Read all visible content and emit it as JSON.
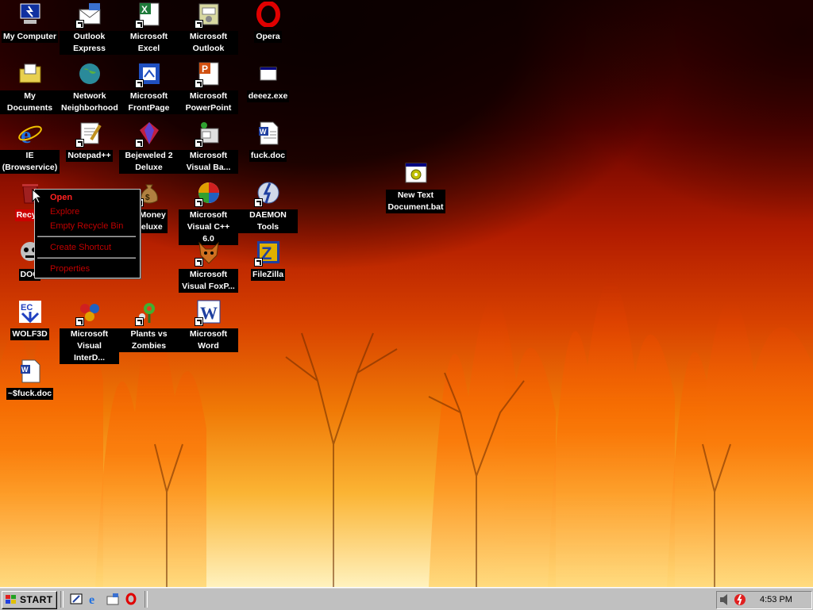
{
  "desktop": {
    "icons": [
      {
        "label": "My Computer",
        "icon": "my-computer-icon",
        "shortcut": false
      },
      {
        "label": "Outlook Express",
        "icon": "outlook-express-icon",
        "shortcut": true
      },
      {
        "label": "Microsoft Excel",
        "icon": "excel-icon",
        "shortcut": true
      },
      {
        "label": "Microsoft Outlook",
        "icon": "outlook-icon",
        "shortcut": true
      },
      {
        "label": "Opera",
        "icon": "opera-icon",
        "shortcut": false
      },
      {
        "label": "My Documents",
        "icon": "my-documents-icon",
        "shortcut": false
      },
      {
        "label": "Network Neighborhood",
        "icon": "network-neighborhood-icon",
        "shortcut": false
      },
      {
        "label": "Microsoft FrontPage",
        "icon": "frontpage-icon",
        "shortcut": true
      },
      {
        "label": "Microsoft PowerPoint",
        "icon": "powerpoint-icon",
        "shortcut": true
      },
      {
        "label": "deeez.exe",
        "icon": "exe-file-icon",
        "shortcut": false
      },
      {
        "label": "IE (Browservice)",
        "icon": "internet-explorer-icon",
        "shortcut": false
      },
      {
        "label": "Notepad++",
        "icon": "notepad-plus-plus-icon",
        "shortcut": true
      },
      {
        "label": "Bejeweled 2 Deluxe",
        "icon": "bejeweled-icon",
        "shortcut": true
      },
      {
        "label": "Microsoft Visual Ba...",
        "icon": "visual-basic-icon",
        "shortcut": true
      },
      {
        "label": "fuck.doc",
        "icon": "word-document-icon",
        "shortcut": false
      },
      {
        "label": "Recycl",
        "icon": "recycle-bin-icon",
        "shortcut": false,
        "selected": true
      },
      {
        "label": "n Money\nDeluxe",
        "icon": "money-bag-icon",
        "shortcut": true
      },
      {
        "label": "Microsoft Visual C++ 6.0",
        "icon": "visual-cpp-icon",
        "shortcut": true
      },
      {
        "label": "DAEMON Tools",
        "icon": "daemon-tools-icon",
        "shortcut": true
      },
      {
        "label": "DOO",
        "icon": "doom-icon",
        "shortcut": false
      },
      {
        "label": "Microsoft Visual FoxP...",
        "icon": "visual-foxpro-icon",
        "shortcut": true
      },
      {
        "label": "FileZilla",
        "icon": "filezilla-icon",
        "shortcut": true
      },
      {
        "label": "WOLF3D",
        "icon": "wolf3d-icon",
        "shortcut": false
      },
      {
        "label": "Microsoft Visual InterD...",
        "icon": "visual-interdev-icon",
        "shortcut": true
      },
      {
        "label": "Plants vs Zombies",
        "icon": "plants-vs-zombies-icon",
        "shortcut": true
      },
      {
        "label": "Microsoft Word",
        "icon": "word-icon",
        "shortcut": true
      },
      {
        "label": "~$fuck.doc",
        "icon": "word-temp-document-icon",
        "shortcut": false
      },
      {
        "label": "New Text Document.bat",
        "icon": "batch-file-icon",
        "shortcut": false
      }
    ]
  },
  "context_menu": {
    "items": [
      {
        "label": "Open",
        "default": true
      },
      {
        "label": "Explore"
      },
      {
        "label": "Empty Recycle Bin"
      },
      {
        "label": "Create Shortcut"
      },
      {
        "label": "Properties"
      }
    ]
  },
  "taskbar": {
    "start_label": "START",
    "quick_launch": [
      "show-desktop-icon",
      "internet-explorer-icon",
      "outlook-express-icon",
      "opera-icon"
    ],
    "tray_icons": [
      "volume-icon",
      "daemon-tools-icon"
    ],
    "clock": "4:53 PM"
  },
  "colors": {
    "menu_text": "#c00000",
    "selected_label": "#cc0000",
    "taskbar": "#c0c0c0"
  }
}
